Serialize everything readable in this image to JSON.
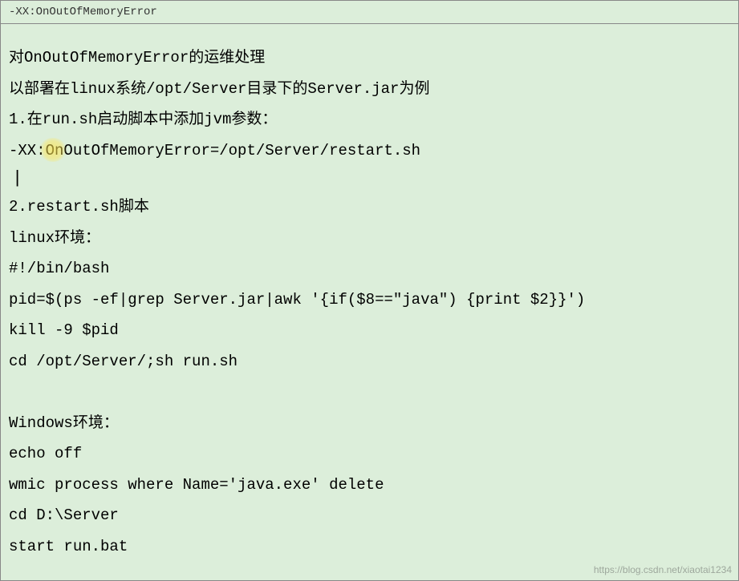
{
  "header": {
    "title": "-XX:OnOutOfMemoryError"
  },
  "intro": {
    "line1": "对OnOutOfMemoryError的运维处理",
    "line2": "以部署在linux系统/opt/Server目录下的Server.jar为例"
  },
  "section1": {
    "heading": "1.在run.sh启动脚本中添加jvm参数：",
    "code1": "-XX:OnOutOfMemoryError=/opt/Server/restart.sh",
    "caret": "|"
  },
  "section2": {
    "heading": "2.restart.sh脚本",
    "linux_label": "linux环境：",
    "linux_lines": {
      "l1": "#!/bin/bash",
      "l2": "pid=$(ps -ef|grep Server.jar|awk '{if($8==\"java\") {print $2}}')",
      "l3": "kill -9 $pid",
      "l4": "cd /opt/Server/;sh run.sh"
    },
    "windows_label": "Windows环境：",
    "windows_lines": {
      "l1": "echo off",
      "l2": "wmic process where Name='java.exe' delete",
      "l3": "cd D:\\Server",
      "l4": "start run.bat"
    }
  },
  "watermark": "https://blog.csdn.net/xiaotai1234"
}
